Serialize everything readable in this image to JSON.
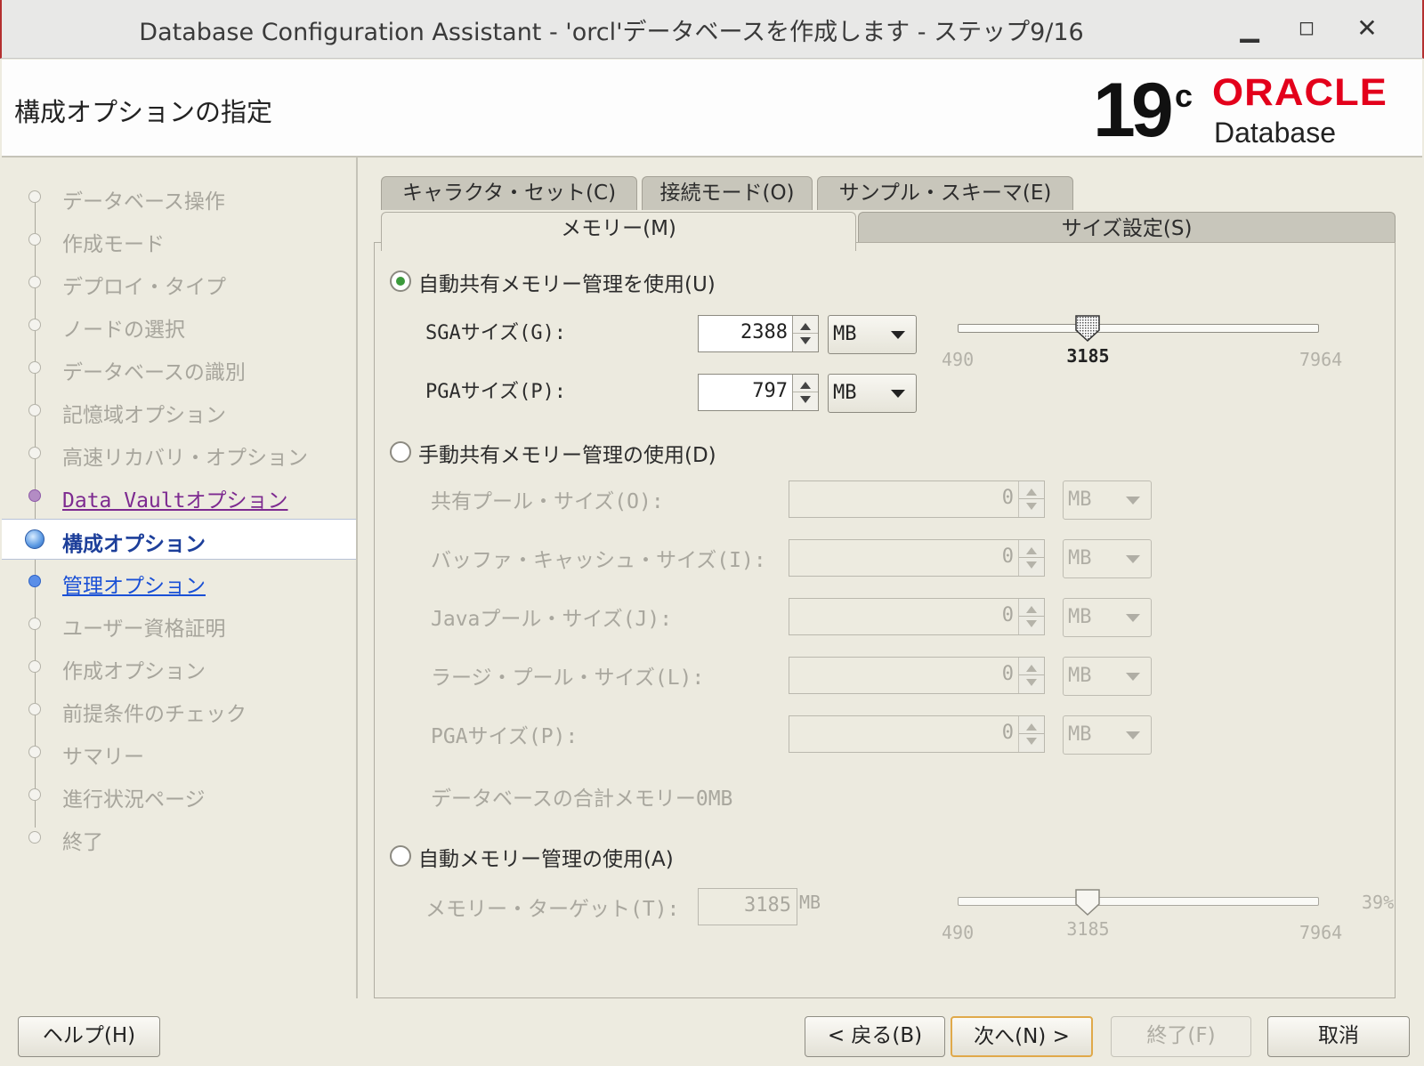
{
  "window": {
    "title": "Database Configuration Assistant - 'orcl'データベースを作成します - ステップ9/16",
    "minimize_icon": "minimize-icon",
    "maximize_icon": "maximize-icon",
    "close_icon": "close-icon"
  },
  "header": {
    "page_title": "構成オプションの指定",
    "logo_version": "19",
    "logo_suffix": "c",
    "logo_brand": "ORACLE",
    "logo_product": "Database",
    "colors": {
      "brand_red": "#e3001b"
    }
  },
  "nav": {
    "items": [
      {
        "label": "データベース操作",
        "state": "disabled"
      },
      {
        "label": "作成モード",
        "state": "disabled"
      },
      {
        "label": "デプロイ・タイプ",
        "state": "disabled"
      },
      {
        "label": "ノードの選択",
        "state": "disabled"
      },
      {
        "label": "データベースの識別",
        "state": "disabled"
      },
      {
        "label": "記憶域オプション",
        "state": "disabled"
      },
      {
        "label": "高速リカバリ・オプション",
        "state": "disabled"
      },
      {
        "label": "Data Vaultオプション",
        "state": "visited"
      },
      {
        "label": "構成オプション",
        "state": "current"
      },
      {
        "label": "管理オプション",
        "state": "link"
      },
      {
        "label": "ユーザー資格証明",
        "state": "disabled"
      },
      {
        "label": "作成オプション",
        "state": "disabled"
      },
      {
        "label": "前提条件のチェック",
        "state": "disabled"
      },
      {
        "label": "サマリー",
        "state": "disabled"
      },
      {
        "label": "進行状況ページ",
        "state": "disabled"
      },
      {
        "label": "終了",
        "state": "disabled"
      }
    ]
  },
  "tabs": {
    "row1": [
      {
        "label": "キャラクタ・セット(C)"
      },
      {
        "label": "接続モード(O)"
      },
      {
        "label": "サンプル・スキーマ(E)"
      }
    ],
    "row2": [
      {
        "label": "メモリー(M)",
        "selected": true
      },
      {
        "label": "サイズ設定(S)",
        "selected": false
      }
    ]
  },
  "memory": {
    "asmm": {
      "label": "自動共有メモリー管理を使用(U)",
      "selected": true,
      "sga_label": "SGAサイズ(G):",
      "sga_value": "2388",
      "sga_unit": "MB",
      "pga_label": "PGAサイズ(P):",
      "pga_value": "797",
      "pga_unit": "MB",
      "slider": {
        "min": 490,
        "max": 7964,
        "value": 3185,
        "min_label": "490",
        "max_label": "7964",
        "value_label": "3185"
      }
    },
    "manual": {
      "label": "手動共有メモリー管理の使用(D)",
      "selected": false,
      "fields": [
        {
          "label": "共有プール・サイズ(O):",
          "value": "0",
          "unit": "MB"
        },
        {
          "label": "バッファ・キャッシュ・サイズ(I):",
          "value": "0",
          "unit": "MB"
        },
        {
          "label": "Javaプール・サイズ(J):",
          "value": "0",
          "unit": "MB"
        },
        {
          "label": "ラージ・プール・サイズ(L):",
          "value": "0",
          "unit": "MB"
        },
        {
          "label": "PGAサイズ(P):",
          "value": "0",
          "unit": "MB"
        }
      ],
      "total": "データベースの合計メモリー0MB"
    },
    "amm": {
      "label": "自動メモリー管理の使用(A)",
      "selected": false,
      "target_label": "メモリー・ターゲット(T):",
      "target_value": "3185",
      "target_unit": "MB",
      "slider": {
        "min": 490,
        "max": 7964,
        "value": 3185,
        "min_label": "490",
        "max_label": "7964",
        "value_label": "3185"
      },
      "percent": "39%"
    }
  },
  "buttons": {
    "help": "ヘルプ(H)",
    "back": "< 戻る(B)",
    "next": "次へ(N) >",
    "finish": "終了(F)",
    "cancel": "取消"
  }
}
